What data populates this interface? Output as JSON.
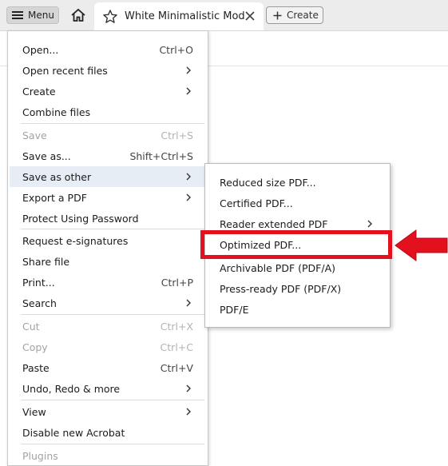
{
  "topbar": {
    "menu_label": "Menu",
    "tab_title": "White Minimalistic Mod...",
    "create_label": "Create"
  },
  "main_menu": {
    "items": [
      {
        "label": "Open...",
        "shortcut": "Ctrl+O"
      },
      {
        "label": "Open recent files",
        "submenu": true
      },
      {
        "label": "Create",
        "submenu": true
      },
      {
        "label": "Combine files"
      },
      {
        "label": "Save",
        "shortcut": "Ctrl+S",
        "disabled": true
      },
      {
        "label": "Save as...",
        "shortcut": "Shift+Ctrl+S"
      },
      {
        "label": "Save as other",
        "submenu": true,
        "active": true
      },
      {
        "label": "Export a PDF",
        "submenu": true
      },
      {
        "label": "Protect Using Password"
      },
      {
        "label": "Request e-signatures"
      },
      {
        "label": "Share file"
      },
      {
        "label": "Print...",
        "shortcut": "Ctrl+P"
      },
      {
        "label": "Search",
        "submenu": true
      },
      {
        "label": "Cut",
        "shortcut": "Ctrl+X",
        "disabled": true
      },
      {
        "label": "Copy",
        "shortcut": "Ctrl+C",
        "disabled": true
      },
      {
        "label": "Paste",
        "shortcut": "Ctrl+V"
      },
      {
        "label": "Undo, Redo & more",
        "submenu": true
      },
      {
        "label": "View",
        "submenu": true
      },
      {
        "label": "Disable new Acrobat"
      },
      {
        "label": "Plugins",
        "disabled": true
      }
    ]
  },
  "save_as_other_submenu": {
    "items": [
      {
        "label": "Reduced size PDF..."
      },
      {
        "label": "Certified PDF..."
      },
      {
        "label": "Reader extended PDF",
        "submenu": true
      },
      {
        "label": "Optimized PDF...",
        "emphasized": true
      },
      {
        "label": "Archivable PDF (PDF/A)"
      },
      {
        "label": "Press-ready PDF (PDF/X)"
      },
      {
        "label": "PDF/E"
      }
    ]
  },
  "annotation": {
    "highlight_color": "#e3101e",
    "arrow_color": "#e3101e"
  }
}
